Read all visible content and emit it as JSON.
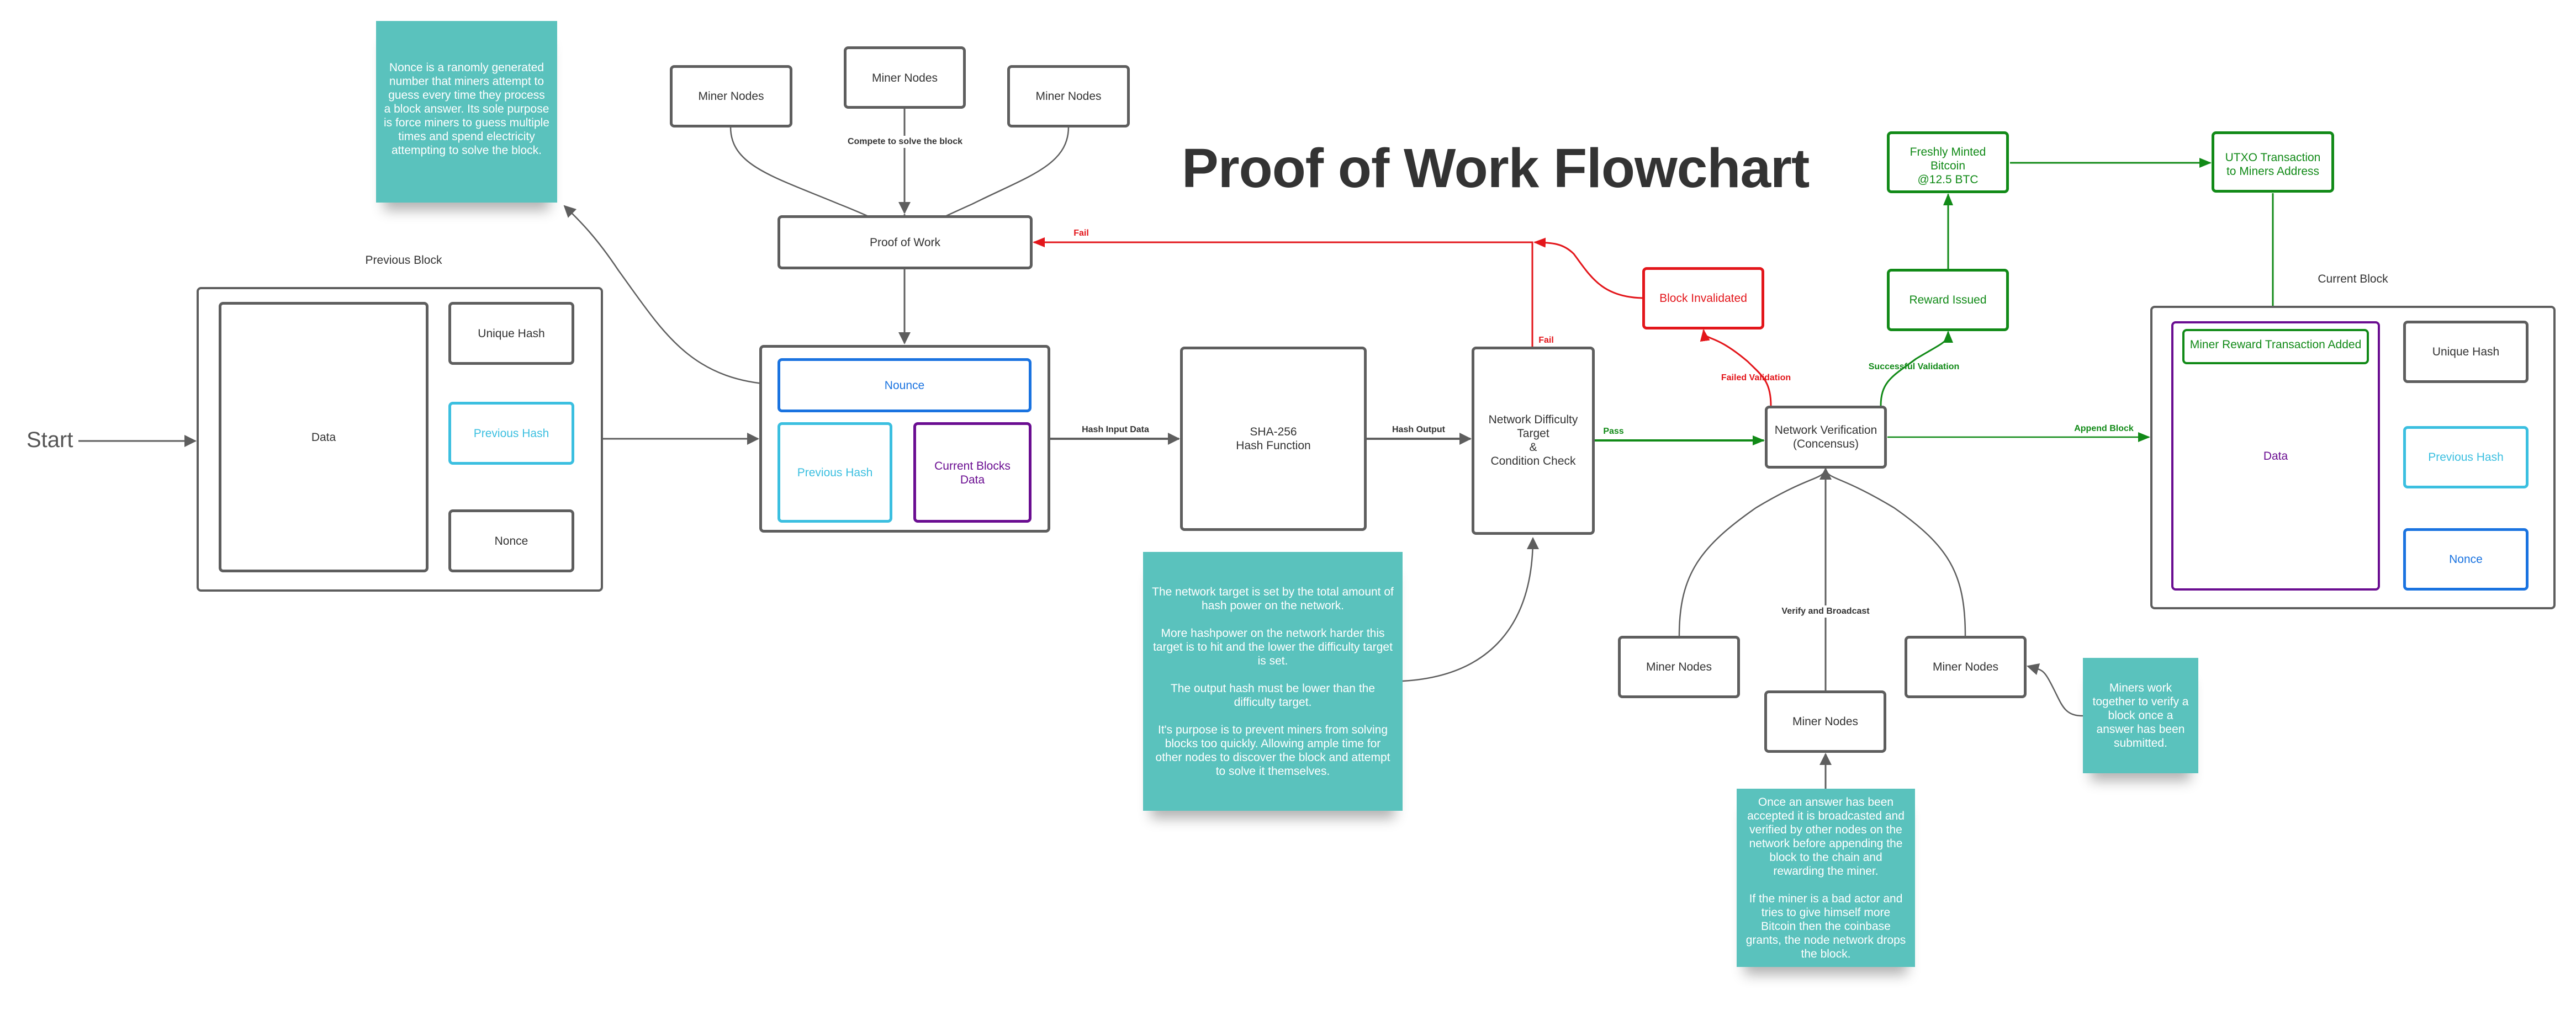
{
  "title": "Proof of Work Flowchart",
  "start_label": "Start",
  "colors": {
    "neutral": "#5e5e5e",
    "text": "#333333",
    "note_bg": "#5ac2bd",
    "fail_red": "#e3161b",
    "pass_green": "#118a17",
    "nonce_blue": "#1a73e0",
    "prev_hash_cyan": "#3bbfe0",
    "data_purple": "#6a0d91"
  },
  "previous_block": {
    "label": "Previous Block",
    "data": "Data",
    "unique_hash": "Unique Hash",
    "previous_hash": "Previous Hash",
    "nonce": "Nonce"
  },
  "nonce_note": "Nonce is a ranomly generated number that miners attempt to guess every time they process a block answer. Its sole purpose is force miners to guess multiple times and spend electricity attempting to solve the block.",
  "competing_miners": {
    "nodes": [
      "Miner Nodes",
      "Miner Nodes",
      "Miner Nodes"
    ],
    "edge_label": "Compete to solve the block"
  },
  "proof_of_work": "Proof of Work",
  "candidate_block": {
    "nonce": "Nounce",
    "previous_hash": "Previous Hash",
    "current_data": "Current Blocks\nData"
  },
  "hash_input_label": "Hash Input Data",
  "sha_box": "SHA-256\nHash Function",
  "hash_output_label": "Hash Output",
  "difficulty_box": "Network Difficulty\nTarget\n&\nCondition Check",
  "difficulty_note": "The network target is set by the total amount of hash power on the network.\n\nMore hashpower on the network harder this target is to hit and the lower the difficulty target is set.\n\nThe output hash must be lower than the difficulty target.\n\nIt's purpose is to prevent miners from solving blocks too quickly. Allowing ample time for other nodes to discover the block and attempt to solve it themselves.",
  "fail_label_top": "Fail",
  "fail_label_return": "Fail",
  "pass_label": "Pass",
  "network_verification": "Network Verification\n(Concensus)",
  "block_invalidated": "Block Invalidated",
  "failed_validation_label": "Failed Validation",
  "reward_issued": "Reward Issued",
  "successful_validation_label": "Successful Validation",
  "freshly_minted": "Freshly Minted\nBitcoin\n@12.5 BTC",
  "utxo_transaction": "UTXO Transaction\nto Miners Address",
  "append_block_label": "Append Block",
  "verifying_miners": {
    "nodes": [
      "Miner Nodes",
      "Miner Nodes",
      "Miner Nodes"
    ],
    "edge_label": "Verify and Broadcast"
  },
  "verify_note": "Miners work together to verify a block once a answer has been submitted.",
  "broadcast_note": "Once an answer has been accepted it is broadcasted and verified by other nodes on the network before appending the block to the chain and rewarding the miner.\n\nIf the miner is a bad actor and tries to give himself more Bitcoin then the coinbase grants, the node network drops the block.",
  "current_block": {
    "label": "Current Block",
    "miner_reward": "Miner Reward Transaction Added",
    "data": "Data",
    "unique_hash": "Unique Hash",
    "previous_hash": "Previous Hash",
    "nonce": "Nonce"
  }
}
